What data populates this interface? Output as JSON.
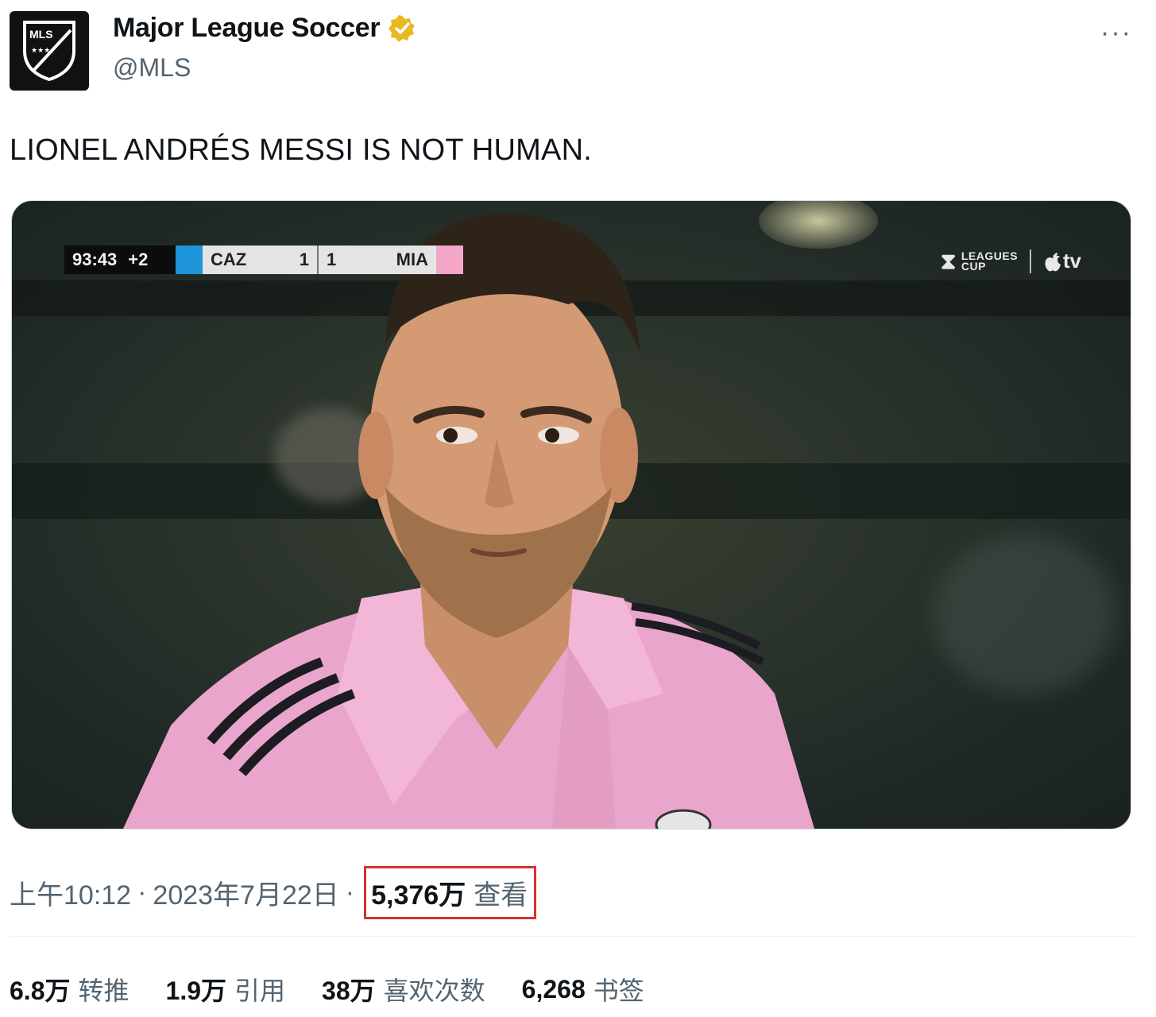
{
  "author": {
    "name": "Major League Soccer",
    "handle": "@MLS",
    "avatar_text": "MLS",
    "verified_color": "#e8b923",
    "icon": "verified-badge-icon"
  },
  "more_label": "···",
  "tweet": {
    "text": "LIONEL ANDRÉS MESSI IS NOT HUMAN."
  },
  "media": {
    "scorebug": {
      "clock": "93:43",
      "added_time": "+2",
      "home_team": "CAZ",
      "home_score": "1",
      "away_score": "1",
      "away_team": "MIA",
      "home_color": "#1e95d8",
      "away_color": "#f3a6c8"
    },
    "broadcast": {
      "league_logo": "LEAGUES CUP",
      "network": "tv"
    }
  },
  "meta": {
    "time": "上午10:12",
    "separator": "·",
    "date": "2023年7月22日",
    "views_count": "5,376万",
    "views_label": "查看",
    "highlight_color": "#d9312d"
  },
  "stats": [
    {
      "num": "6.8万",
      "label": "转推"
    },
    {
      "num": "1.9万",
      "label": "引用"
    },
    {
      "num": "38万",
      "label": "喜欢次数"
    },
    {
      "num": "6,268",
      "label": "书签"
    }
  ]
}
